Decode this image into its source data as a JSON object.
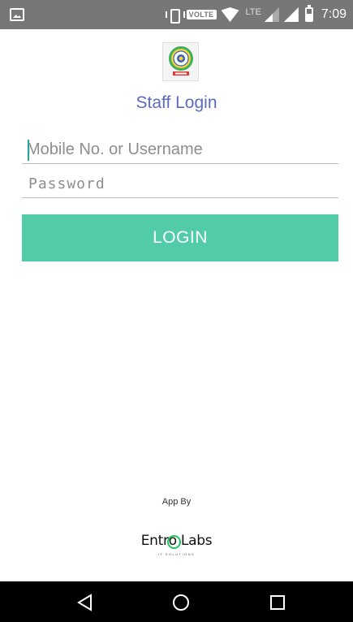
{
  "status_bar": {
    "volte_label": "VOLTE",
    "lte_label": "LTE",
    "time": "7:09"
  },
  "screen": {
    "title": "Staff Login"
  },
  "form": {
    "username_placeholder": "Mobile No. or Username",
    "password_placeholder": "Password",
    "login_label": "LOGIN"
  },
  "footer": {
    "app_by": "App By",
    "brand_part1": "Entr",
    "brand_o": "o",
    "brand_part2": " Labs",
    "tagline": "IT SOLUTIONS"
  },
  "colors": {
    "accent": "#52cba8",
    "title": "#3f51b5",
    "cursor": "#26a69a",
    "brand_ring": "#22c55e"
  },
  "icons": {
    "status_left": "image-icon",
    "vibrate": "vibrate-icon",
    "wifi": "wifi-icon",
    "signal": "signal-icon",
    "battery": "battery-icon",
    "nav_back": "back-icon",
    "nav_home": "home-icon",
    "nav_recent": "recent-apps-icon"
  }
}
